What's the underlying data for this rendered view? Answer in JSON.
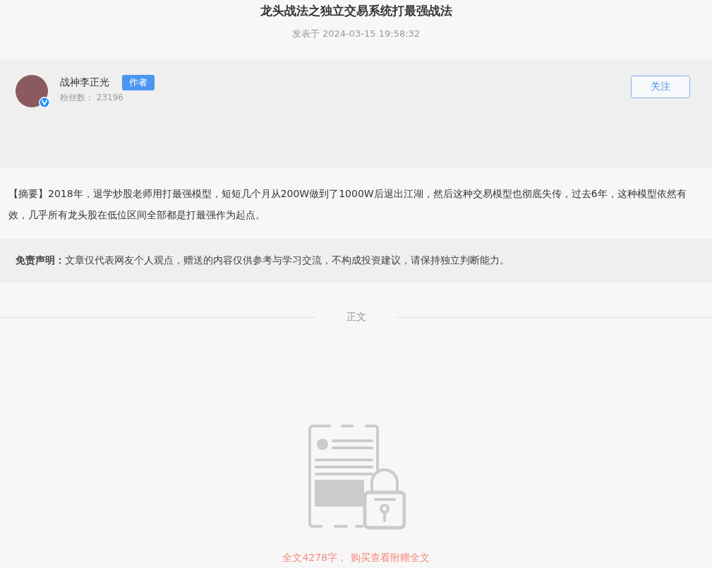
{
  "article": {
    "title": "龙头战法之独立交易系统打最强战法",
    "published": "发表于 2024-03-15 19:58:32"
  },
  "author": {
    "name": "战神李正光",
    "badge": "作者",
    "followers": "粉丝数： 23196",
    "verified": true,
    "follow_button": "关注"
  },
  "summary": "【摘要】2018年，退学炒股老师用打最强模型，短短几个月从200W做到了1000W后退出江湖，然后这种交易模型也彻底失传，过去6年，这种模型依然有效，几乎所有龙头股在低位区间全部都是打最强作为起点。",
  "disclaimer": "**免责声明：**文章仅代表网友个人观点，赠送的内容仅供参考与学习交流，不构成投资建议，请保持独立判断能力。",
  "section_label": "正文",
  "locked_notice": "全文4278字， 购买查看附赠全文"
}
